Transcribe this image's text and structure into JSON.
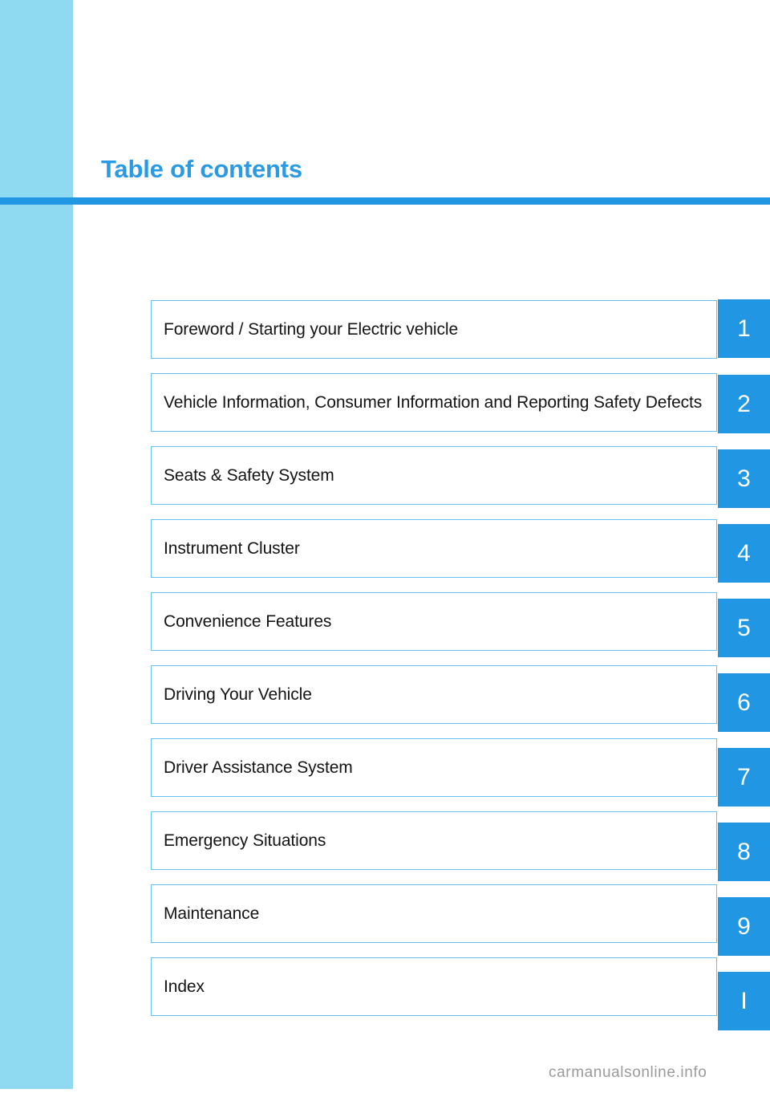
{
  "page": {
    "title": "Table of contents",
    "watermark": "carmanualsonline.info",
    "accent_color": "#2196e3",
    "band_color": "#8fdaf0",
    "border_color": "#66c3f0"
  },
  "toc": {
    "rows": [
      {
        "label": "Foreword / Starting your Electric vehicle",
        "number": "1",
        "offset": -1
      },
      {
        "label": "Vehicle Information, Consumer Information and Reporting Safety Defects",
        "number": "2",
        "offset": 2
      },
      {
        "label": "Seats & Safety System",
        "number": "3",
        "offset": 4
      },
      {
        "label": "Instrument Cluster",
        "number": "4",
        "offset": 6
      },
      {
        "label": "Convenience Features",
        "number": "5",
        "offset": 8
      },
      {
        "label": "Driving Your Vehicle",
        "number": "6",
        "offset": 10
      },
      {
        "label": "Driver Assistance System",
        "number": "7",
        "offset": 12
      },
      {
        "label": "Emergency Situations",
        "number": "8",
        "offset": 14
      },
      {
        "label": "Maintenance",
        "number": "9",
        "offset": 16
      },
      {
        "label": "Index",
        "number": "I",
        "offset": 18
      }
    ]
  }
}
